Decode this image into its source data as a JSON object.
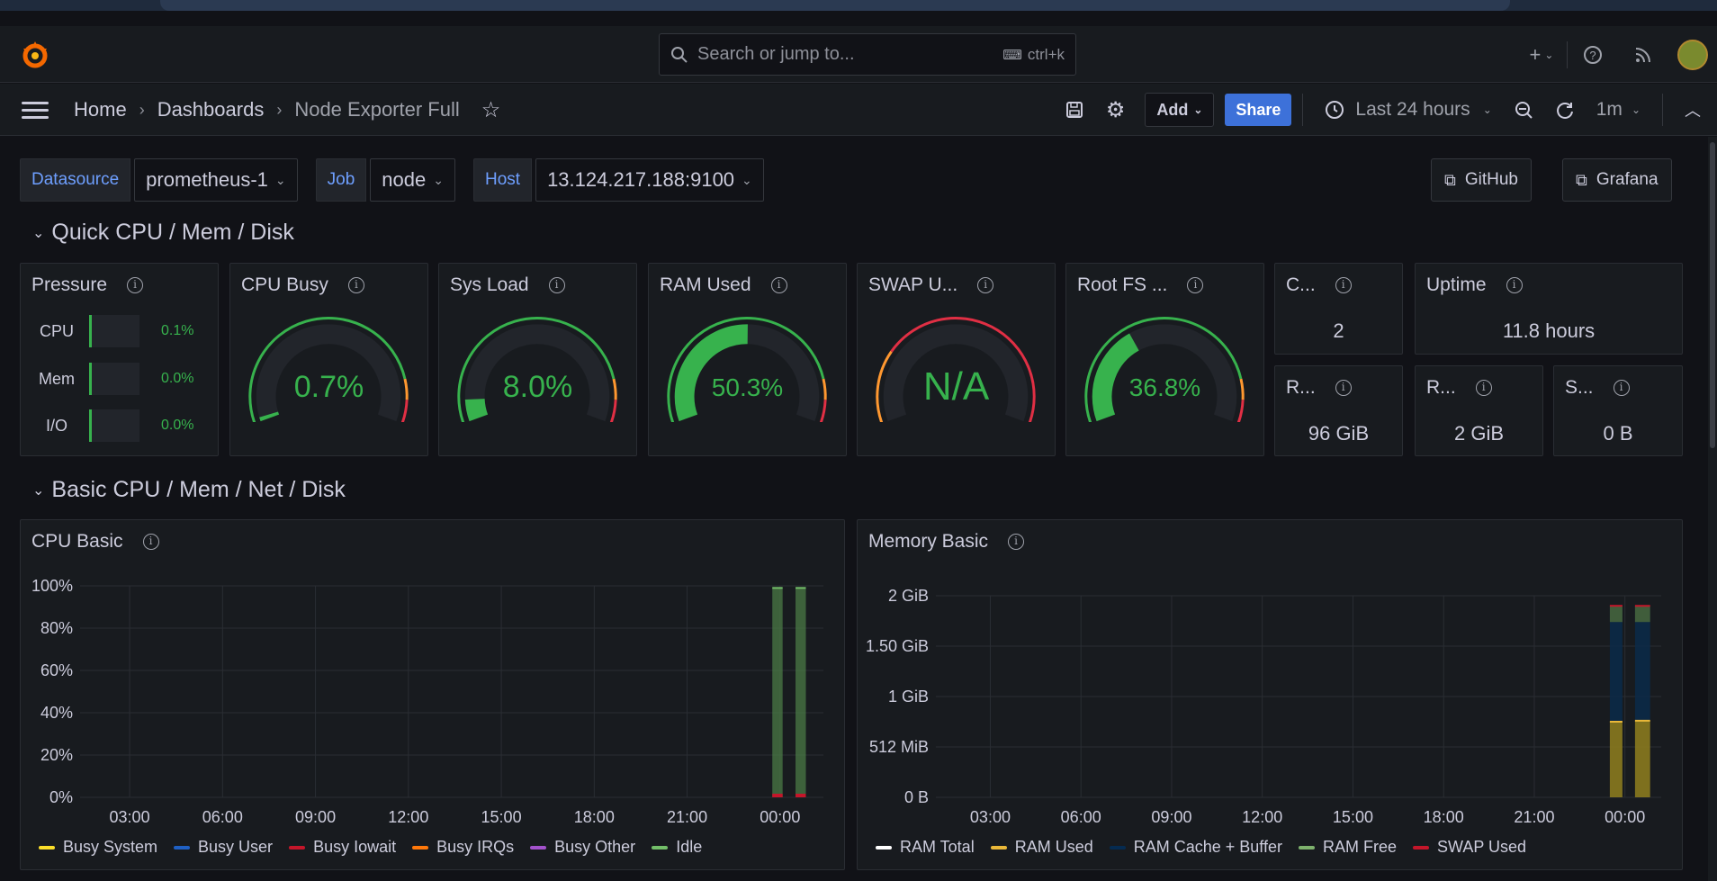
{
  "topbar": {
    "search_placeholder": "Search or jump to...",
    "search_shortcut": "ctrl+k"
  },
  "navbar": {
    "breadcrumb": [
      "Home",
      "Dashboards",
      "Node Exporter Full"
    ],
    "add_label": "Add",
    "share_label": "Share",
    "time_range": "Last 24 hours",
    "refresh_interval": "1m"
  },
  "variables": [
    {
      "label": "Datasource",
      "value": "prometheus-1"
    },
    {
      "label": "Job",
      "value": "node"
    },
    {
      "label": "Host",
      "value": "13.124.217.188:9100"
    }
  ],
  "links": {
    "github": "GitHub",
    "grafana": "Grafana"
  },
  "rows": {
    "quick": "Quick CPU / Mem / Disk",
    "basic": "Basic CPU / Mem / Net / Disk"
  },
  "pressure": {
    "title": "Pressure",
    "items": [
      {
        "label": "CPU",
        "value": "0.1%"
      },
      {
        "label": "Mem",
        "value": "0.0%"
      },
      {
        "label": "I/O",
        "value": "0.0%"
      }
    ]
  },
  "gauges": [
    {
      "title": "CPU Busy",
      "value": "0.7%",
      "fraction": 0.007
    },
    {
      "title": "Sys Load",
      "value": "8.0%",
      "fraction": 0.08
    },
    {
      "title": "RAM Used",
      "value": "50.3%",
      "fraction": 0.503
    },
    {
      "title": "SWAP U...",
      "value": "N/A",
      "fraction": 0
    },
    {
      "title": "Root FS ...",
      "value": "36.8%",
      "fraction": 0.368
    }
  ],
  "stats": {
    "cores": {
      "title": "C...",
      "value": "2"
    },
    "uptime": {
      "title": "Uptime",
      "value": "11.8 hours"
    },
    "rootfs_total": {
      "title": "R...",
      "value": "96 GiB"
    },
    "ram_total": {
      "title": "R...",
      "value": "2 GiB"
    },
    "swap_total": {
      "title": "S...",
      "value": "0 B"
    }
  },
  "colors": {
    "green": "#37b24d",
    "orange": "#ff9830",
    "red": "#e02f44",
    "accent": "#3d71d9"
  },
  "chart_data": [
    {
      "type": "area",
      "title": "CPU Basic",
      "x": [
        "03:00",
        "06:00",
        "09:00",
        "12:00",
        "15:00",
        "18:00",
        "21:00",
        "00:00"
      ],
      "y_ticks": [
        "100%",
        "80%",
        "60%",
        "40%",
        "20%",
        "0%"
      ],
      "ylim": [
        0,
        100
      ],
      "series": [
        {
          "name": "Busy System",
          "color": "#fade2a"
        },
        {
          "name": "Busy User",
          "color": "#1f60c4"
        },
        {
          "name": "Busy Iowait",
          "color": "#c4162a"
        },
        {
          "name": "Busy IRQs",
          "color": "#ff780a"
        },
        {
          "name": "Busy Other",
          "color": "#a352cc"
        },
        {
          "name": "Idle",
          "color": "#73bf69"
        }
      ],
      "active_segments": [
        {
          "start": "23:45",
          "end": "00:05",
          "idle_pct": 99
        },
        {
          "start": "00:30",
          "end": "00:50",
          "idle_pct": 99
        }
      ]
    },
    {
      "type": "area",
      "title": "Memory Basic",
      "x": [
        "03:00",
        "06:00",
        "09:00",
        "12:00",
        "15:00",
        "18:00",
        "21:00",
        "00:00"
      ],
      "y_ticks": [
        "2 GiB",
        "1.50 GiB",
        "1 GiB",
        "512 MiB",
        "0 B"
      ],
      "ylim": [
        0,
        2
      ],
      "series": [
        {
          "name": "RAM Total",
          "color": "#ffffff"
        },
        {
          "name": "RAM Used",
          "color": "#eab839"
        },
        {
          "name": "RAM Cache + Buffer",
          "color": "#052b51"
        },
        {
          "name": "RAM Free",
          "color": "#7eb26d"
        },
        {
          "name": "SWAP Used",
          "color": "#c4162a"
        }
      ],
      "active_segments": [
        {
          "start": "23:30",
          "end": "23:55",
          "used_gib": 0.75,
          "total_gib": 1.9
        },
        {
          "start": "00:20",
          "end": "00:50",
          "used_gib": 0.76,
          "total_gib": 1.9
        }
      ]
    }
  ]
}
